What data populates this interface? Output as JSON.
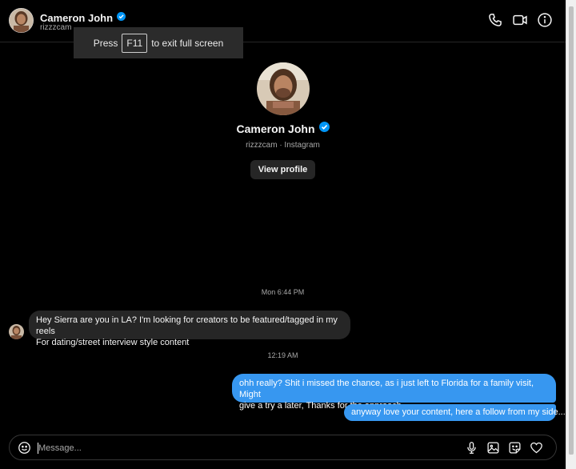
{
  "header": {
    "name": "Cameron John",
    "username": "rizzzcam"
  },
  "toast": {
    "before": "Press",
    "key": "F11",
    "after": "to exit full screen"
  },
  "profile": {
    "name": "Cameron John",
    "subtitle": "rizzzcam · Instagram",
    "view_profile_label": "View profile"
  },
  "thread": {
    "timestamp_1": "Mon 6:44 PM",
    "incoming_message": {
      "line1": "Hey Sierra are you in LA? I'm looking for creators to be featured/tagged in my reels",
      "line2": "For dating/street interview style content"
    },
    "timestamp_2": "12:19 AM",
    "outgoing_message_1": {
      "line1": "ohh really? Shit i missed the chance, as i just left to Florida for a family visit, Might",
      "line2": "give a try a later, Thanks for the approach"
    },
    "outgoing_message_2": "anyway love your content, here a follow from my side..."
  },
  "composer": {
    "placeholder": "Message..."
  },
  "colors": {
    "background": "#000000",
    "incoming_bubble": "#262626",
    "outgoing_bubble": "#3797f0",
    "verified_badge": "#0095f6",
    "secondary_text": "#a8a8a8"
  },
  "icons": {
    "header": [
      "phone-icon",
      "video-call-icon",
      "info-icon"
    ],
    "composer": [
      "emoji-icon",
      "microphone-icon",
      "image-icon",
      "sticker-icon",
      "heart-icon"
    ]
  }
}
